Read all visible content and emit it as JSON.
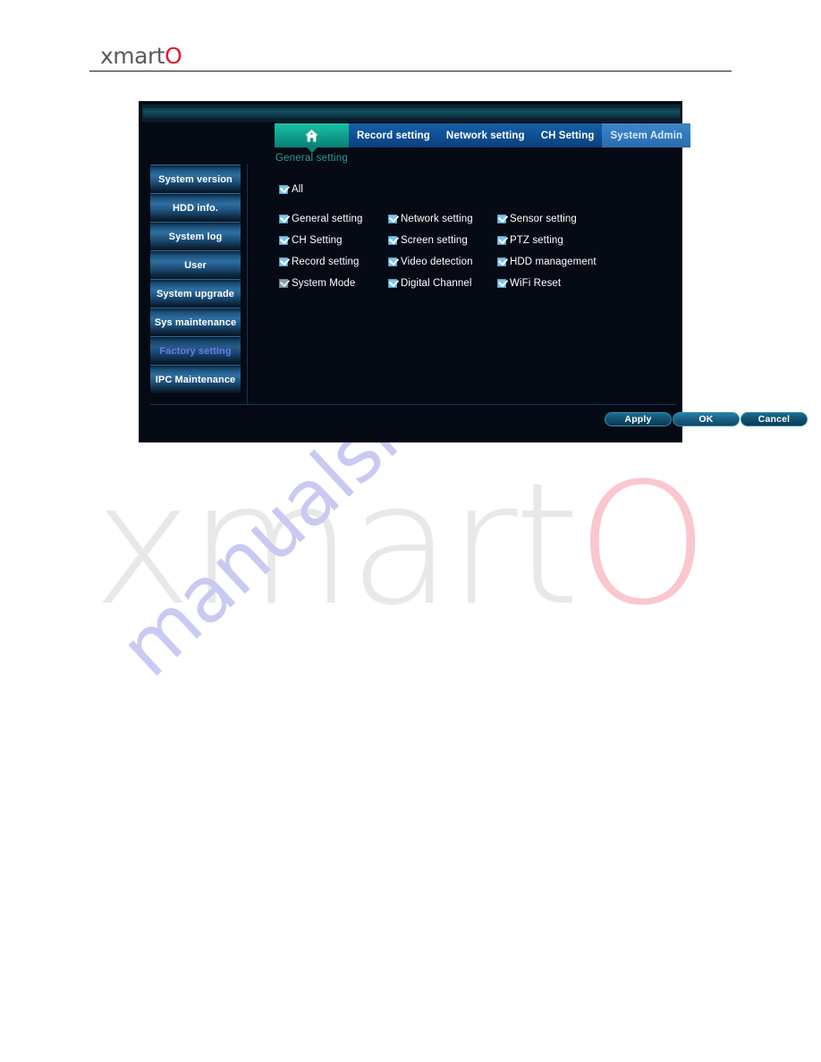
{
  "page": {
    "brand_text": "xmart",
    "brand_mark": "O",
    "watermark_brand": "xmart",
    "watermark_brand_mark": "O",
    "watermark_diagonal": "manualshive"
  },
  "dvr": {
    "tabs": [
      {
        "label": "",
        "icon": "home-icon",
        "active": true
      },
      {
        "label": "Record setting",
        "active": false
      },
      {
        "label": "Network setting",
        "active": false
      },
      {
        "label": "CH Setting",
        "active": false
      },
      {
        "label": "System Admin",
        "active": true
      }
    ],
    "subtitle": "General setting",
    "sidebar": {
      "items": [
        {
          "label": "System version",
          "selected": false
        },
        {
          "label": "HDD info.",
          "selected": false
        },
        {
          "label": "System log",
          "selected": false
        },
        {
          "label": "User",
          "selected": false
        },
        {
          "label": "System upgrade",
          "selected": false
        },
        {
          "label": "Sys maintenance",
          "selected": false
        },
        {
          "label": "Factory setting",
          "selected": true
        },
        {
          "label": "IPC Maintenance",
          "selected": false
        }
      ]
    },
    "select_all": {
      "label": "All",
      "checked": true,
      "disabled": false
    },
    "checkbox_rows": [
      [
        {
          "label": "General setting",
          "checked": true,
          "disabled": false
        },
        {
          "label": "Network setting",
          "checked": true,
          "disabled": false
        },
        {
          "label": "Sensor setting",
          "checked": true,
          "disabled": false
        }
      ],
      [
        {
          "label": "CH Setting",
          "checked": true,
          "disabled": false
        },
        {
          "label": "Screen setting",
          "checked": true,
          "disabled": false
        },
        {
          "label": "PTZ setting",
          "checked": true,
          "disabled": false
        }
      ],
      [
        {
          "label": "Record setting",
          "checked": true,
          "disabled": false
        },
        {
          "label": "Video detection",
          "checked": true,
          "disabled": false
        },
        {
          "label": "HDD management",
          "checked": true,
          "disabled": false
        }
      ],
      [
        {
          "label": "System Mode",
          "checked": true,
          "disabled": true
        },
        {
          "label": "Digital Channel",
          "checked": true,
          "disabled": false
        },
        {
          "label": "WiFi Reset",
          "checked": true,
          "disabled": false
        }
      ]
    ],
    "buttons": [
      {
        "label": "Apply",
        "primary": false
      },
      {
        "label": "OK",
        "primary": true
      },
      {
        "label": "Cancel",
        "primary": false
      }
    ]
  },
  "colors": {
    "accent_teal": "#18c3a6",
    "tab_blue": "#1560a8",
    "tab_active_blue": "#3c86c8",
    "brand_red": "#d81e30",
    "selected_sidebar_text": "#6f79e8",
    "subtitle_teal": "#2f9c95",
    "checkbox_fill": "#7cc6e8"
  }
}
